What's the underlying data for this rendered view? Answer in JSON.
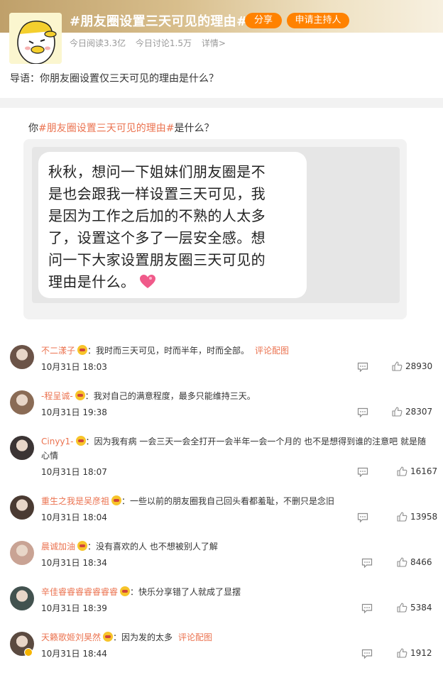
{
  "topic": {
    "title": "#朋友圈设置三天可见的理由#",
    "share_label": "分享",
    "host_label": "申请主持人",
    "reads": "今日阅读3.3亿",
    "discussions": "今日讨论1.5万",
    "details": "详情>",
    "intro": "导语：你朋友圈设置仅三天可见的理由是什么？"
  },
  "card": {
    "question_prefix": "你",
    "question_tag": "#朋友圈设置三天可见的理由#",
    "question_suffix": "是什么？",
    "bubble_lines": [
      "秋秋，想问一下姐妹们朋友圈是不",
      "是也会跟我一样设置三天可见，我",
      "是因为工作之后加的不熟的人太多",
      "了，设置这个多了一层安全感。想",
      "问一下大家设置朋友圈三天可见的",
      "理由是什么。"
    ]
  },
  "comments": [
    {
      "name": "不二漾子",
      "text": "我时而三天可见，时而半年，时而全部。",
      "link": "评论配图",
      "time": "10月31日 18:03",
      "likes": "28930",
      "avatar_color": "#6b5347"
    },
    {
      "name": "-程呈诚-",
      "text": "我对自己的满意程度，最多只能维持三天。",
      "link": "",
      "time": "10月31日 19:38",
      "likes": "28307",
      "avatar_color": "#8a6b55"
    },
    {
      "name": "Cinyy1-",
      "text": "因为我有病 一会三天一会全打开一会半年一会一个月的 也不是想得到谁的注意吧 就是随心情",
      "link": "",
      "time": "10月31日 18:07",
      "likes": "16167",
      "avatar_color": "#3b3434"
    },
    {
      "name": "重生之我是吴彦祖",
      "text": "一些以前的朋友圈我自己回头看都羞耻，不删只是念旧",
      "link": "",
      "time": "10月31日 18:04",
      "likes": "13958",
      "avatar_color": "#4a3a32"
    },
    {
      "name": "晨诚加油",
      "text": "没有喜欢的人 也不想被别人了解",
      "link": "",
      "time": "10月31日 18:34",
      "likes": "8466",
      "avatar_color": "#c9a394"
    },
    {
      "name": "辛佳睿睿睿睿睿睿睿",
      "text": "快乐分享错了人就成了显摆",
      "link": "",
      "time": "10月31日 18:39",
      "likes": "5384",
      "avatar_color": "#42524f"
    },
    {
      "name": "天籁歌姬刘昊然",
      "text": "因为发的太多",
      "link": "评论配图",
      "time": "10月31日 18:44",
      "likes": "1912",
      "avatar_color": "#5b4a40"
    }
  ]
}
